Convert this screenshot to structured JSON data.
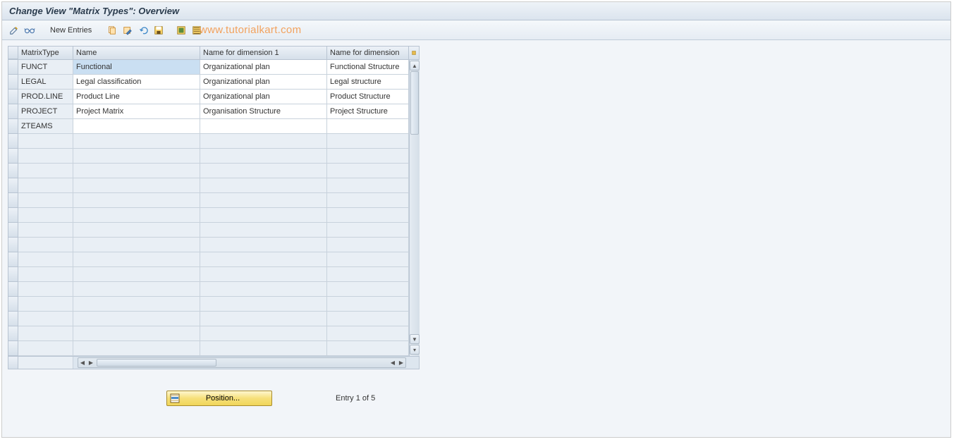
{
  "title": "Change View \"Matrix Types\": Overview",
  "watermark": "www.tutorialkart.com",
  "toolbar": {
    "new_entries_label": "New Entries"
  },
  "grid": {
    "headers": {
      "matrix_type": "MatrixType",
      "name": "Name",
      "dim1": "Name for dimension 1",
      "dim2": "Name for dimension"
    },
    "rows": [
      {
        "matrix_type": "FUNCT",
        "name": "Functional",
        "dim1": "Organizational plan",
        "dim2": "Functional Structure",
        "selected_name": true
      },
      {
        "matrix_type": "LEGAL",
        "name": "Legal classification",
        "dim1": "Organizational plan",
        "dim2": "Legal structure"
      },
      {
        "matrix_type": "PROD.LINE",
        "name": "Product Line",
        "dim1": "Organizational plan",
        "dim2": "Product Structure"
      },
      {
        "matrix_type": "PROJECT",
        "name": "Project Matrix",
        "dim1": "Organisation Structure",
        "dim2": "Project Structure"
      },
      {
        "matrix_type": "ZTEAMS",
        "name": "",
        "dim1": "",
        "dim2": ""
      }
    ],
    "total_visible_rows": 20
  },
  "footer": {
    "position_label": "Position...",
    "entry_status": "Entry 1 of 5"
  }
}
